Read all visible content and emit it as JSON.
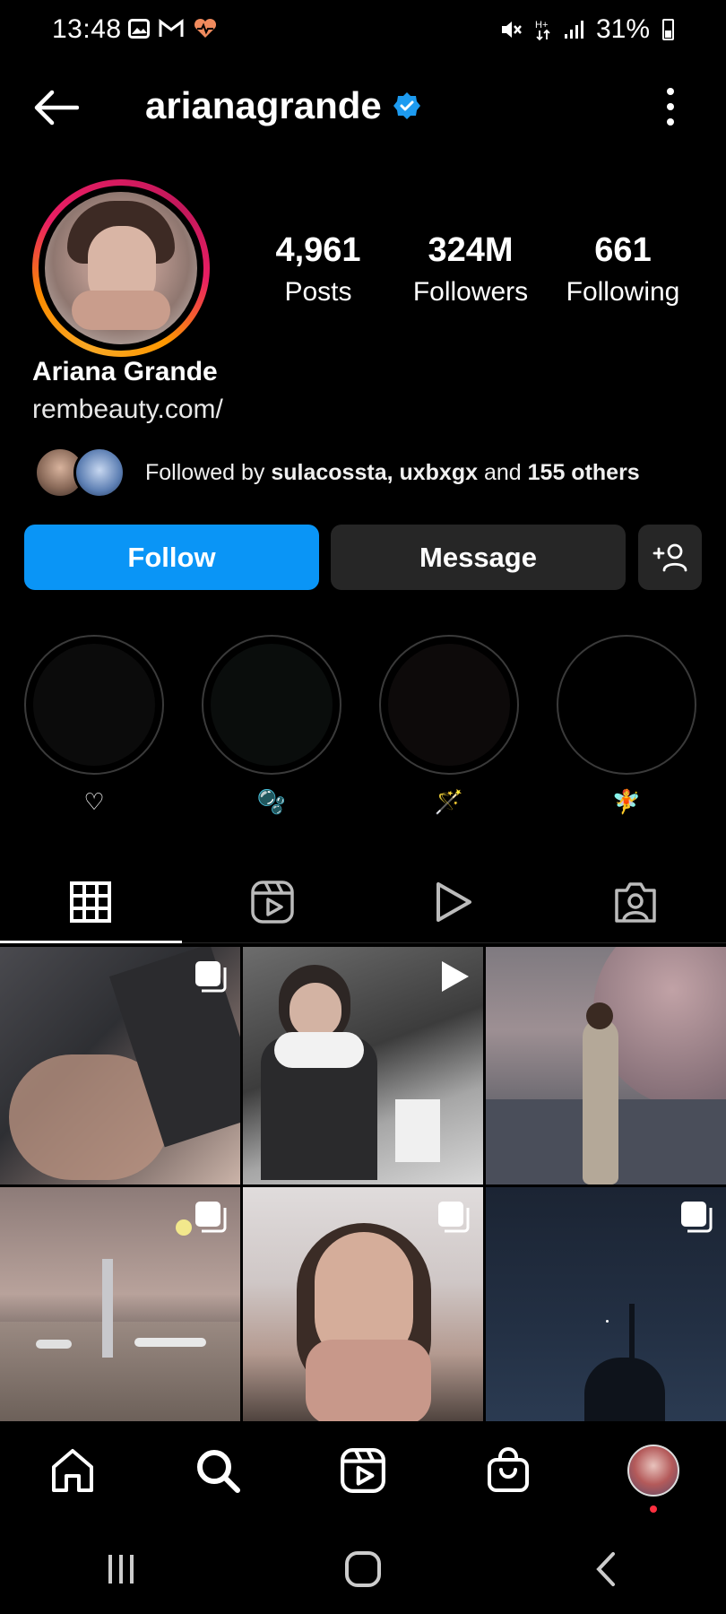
{
  "status_bar": {
    "time": "13:48",
    "battery": "31%"
  },
  "header": {
    "username": "arianagrande",
    "verified": true
  },
  "profile": {
    "full_name": "Ariana Grande",
    "link": "rembeauty.com/",
    "stats": [
      {
        "value": "4,961",
        "label": "Posts"
      },
      {
        "value": "324M",
        "label": "Followers"
      },
      {
        "value": "661",
        "label": "Following"
      }
    ],
    "followed_by": {
      "prefix": "Followed by",
      "names": "sulacossta, uxbxgx",
      "middle": "and",
      "others": "155 others"
    }
  },
  "actions": {
    "follow": "Follow",
    "message": "Message"
  },
  "highlights": [
    {
      "label": "♡"
    },
    {
      "label": "🫧"
    },
    {
      "label": "🪄"
    },
    {
      "label": "🧚"
    }
  ],
  "tabs": [
    "grid",
    "reels",
    "videos",
    "tagged"
  ],
  "colors": {
    "follow_button": "#0a95f6",
    "secondary_button": "#262626",
    "verified": "#1d9bf0",
    "notification_dot": "#ff3040"
  }
}
